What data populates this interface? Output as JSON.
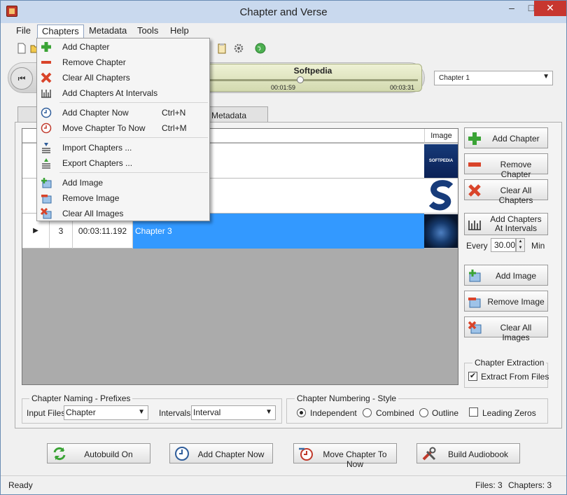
{
  "window": {
    "title": "Chapter and Verse"
  },
  "menubar": [
    "File",
    "Chapters",
    "Metadata",
    "Tools",
    "Help"
  ],
  "player": {
    "title": "Softpedia",
    "position": "00:01:59",
    "duration": "00:03:31"
  },
  "chapter_select": {
    "value": "Chapter 1"
  },
  "tabs": {
    "metadata": "Metadata"
  },
  "grid": {
    "image_header": "Image",
    "rows": [
      {
        "num": "",
        "time": "",
        "title": "",
        "selected": false
      },
      {
        "num": "",
        "time": "",
        "title": "",
        "selected": false
      },
      {
        "num": "3",
        "time": "00:03:11.192",
        "title": "Chapter 3",
        "selected": true,
        "arrow": "▶"
      }
    ],
    "image_a_text": "SOFTPEDIA"
  },
  "side_buttons": {
    "add_chapter": "Add Chapter",
    "remove_chapter": "Remove Chapter",
    "clear_all_chapters": "Clear All Chapters",
    "add_chapters_at_intervals_l1": "Add Chapters",
    "add_chapters_at_intervals_l2": "At Intervals",
    "add_image": "Add Image",
    "remove_image": "Remove Image",
    "clear_all_images": "Clear All Images"
  },
  "interval": {
    "label": "Every",
    "value": "30.00",
    "unit": "Min"
  },
  "extraction": {
    "title": "Chapter Extraction",
    "checkbox_label": "Extract From Files",
    "checked": "✔"
  },
  "naming": {
    "title": "Chapter Naming - Prefixes",
    "input_files_label": "Input Files",
    "input_files_value": "Chapter",
    "intervals_label": "Intervals",
    "intervals_value": "Interval"
  },
  "numbering": {
    "title": "Chapter Numbering - Style",
    "options": [
      "Independent",
      "Combined",
      "Outline"
    ],
    "selected": "Independent",
    "leading_zeros": "Leading Zeros"
  },
  "bottom_buttons": {
    "autobuild": "Autobuild On",
    "add_chapter_now": "Add Chapter Now",
    "move_chapter_to_now": "Move Chapter To Now",
    "build_audiobook": "Build Audiobook"
  },
  "status": {
    "left": "Ready",
    "files": "Files: 3",
    "chapters": "Chapters: 3"
  },
  "chapters_menu": {
    "items": [
      {
        "label": "Add Chapter",
        "shortcut": "",
        "icon": "plus-icon"
      },
      {
        "label": "Remove Chapter",
        "shortcut": "",
        "icon": "minus-icon"
      },
      {
        "label": "Clear All Chapters",
        "shortcut": "",
        "icon": "x-icon"
      },
      {
        "label": "Add Chapters At Intervals",
        "shortcut": "",
        "icon": "intervals-icon"
      },
      {
        "label": "Add Chapter Now",
        "shortcut": "Ctrl+N",
        "icon": "clock-icon"
      },
      {
        "label": "Move Chapter To Now",
        "shortcut": "Ctrl+M",
        "icon": "clock-move-icon"
      },
      {
        "label": "Import Chapters ...",
        "shortcut": "",
        "icon": "import-icon"
      },
      {
        "label": "Export Chapters ...",
        "shortcut": "",
        "icon": "export-icon"
      },
      {
        "label": "Add Image",
        "shortcut": "",
        "icon": "add-image-icon"
      },
      {
        "label": "Remove Image",
        "shortcut": "",
        "icon": "remove-image-icon"
      },
      {
        "label": "Clear All Images",
        "shortcut": "",
        "icon": "clear-images-icon"
      }
    ]
  },
  "colors": {
    "selection": "#3399ff",
    "accent_green": "#3aa335",
    "accent_red": "#d9442a"
  }
}
